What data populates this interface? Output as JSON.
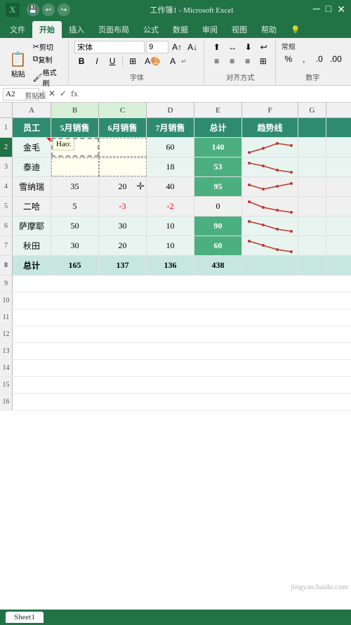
{
  "titlebar": {
    "icon": "X",
    "title": "工作簿1 - Microsoft Excel"
  },
  "ribbon": {
    "tabs": [
      "文件",
      "开始",
      "插入",
      "页面布局",
      "公式",
      "数据",
      "审阅",
      "视图",
      "帮助"
    ],
    "active_tab": "开始",
    "clipboard_label": "剪贴板",
    "font_label": "字体",
    "align_label": "对齐方式",
    "cut_label": "剪切",
    "copy_label": "复制",
    "paste_label": "粘贴",
    "format_painter_label": "格式刷",
    "font_name": "宋体",
    "font_size": "9",
    "bold_label": "B",
    "italic_label": "I",
    "underline_label": "U"
  },
  "formula_bar": {
    "cell_ref": "A2",
    "formula": ""
  },
  "columns": {
    "headers": [
      "A",
      "B",
      "C",
      "D",
      "E",
      "F",
      "G"
    ],
    "widths": [
      55,
      68,
      68,
      68,
      68,
      80,
      40
    ]
  },
  "rows": {
    "header_row": {
      "cells": [
        "员工",
        "5月销售",
        "6月销售",
        "7月销售",
        "总计",
        "趋势线",
        ""
      ]
    },
    "data": [
      {
        "num": 2,
        "cells": [
          "金毛",
          "",
          "",
          "60",
          "140",
          "sparkline_up",
          ""
        ],
        "e_green": true
      },
      {
        "num": 3,
        "cells": [
          "泰迪",
          "",
          "",
          "18",
          "53",
          "sparkline_down",
          ""
        ],
        "e_green": true
      },
      {
        "num": 4,
        "cells": [
          "雪纳瑞",
          "35",
          "20",
          "40",
          "95",
          "sparkline_flat",
          ""
        ],
        "e_green": true
      },
      {
        "num": 5,
        "cells": [
          "二哈",
          "5",
          "-3",
          "-2",
          "0",
          "sparkline_neg",
          ""
        ]
      },
      {
        "num": 6,
        "cells": [
          "萨摩耶",
          "50",
          "30",
          "10",
          "90",
          "sparkline_down2",
          ""
        ],
        "e_green": true
      },
      {
        "num": 7,
        "cells": [
          "秋田",
          "30",
          "20",
          "10",
          "60",
          "sparkline_down3",
          ""
        ],
        "e_green": true
      }
    ],
    "total_row": {
      "num": 8,
      "cells": [
        "总计",
        "165",
        "137",
        "136",
        "438",
        "",
        ""
      ]
    }
  },
  "note": {
    "text": "Hao:",
    "visible": true
  },
  "empty_rows": [
    9,
    10,
    11,
    12,
    13,
    14,
    15,
    16
  ],
  "bottom": {
    "sheet_tab": "Sheet1",
    "watermark": "jingyan.baidu.com"
  }
}
